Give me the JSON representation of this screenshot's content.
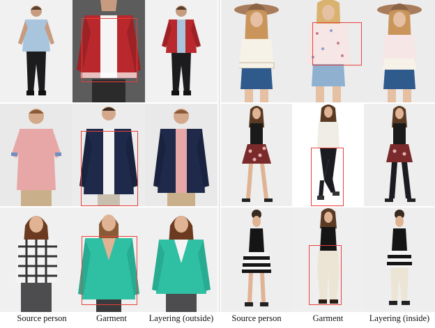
{
  "left_group": {
    "columns": [
      "Source person",
      "Garment",
      "Layering (outside)"
    ]
  },
  "right_group": {
    "columns": [
      "Source person",
      "Garment",
      "Layering (inside)"
    ]
  },
  "colors": {
    "highlight_box": "#e8413c",
    "background": "#ffffff"
  }
}
